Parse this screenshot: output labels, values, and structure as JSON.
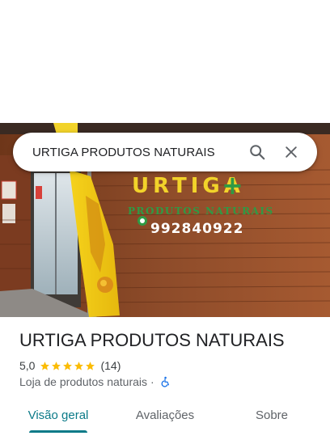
{
  "search": {
    "query": "URTIGA PRODUTOS NATURAIS",
    "search_icon": "search-icon",
    "close_icon": "close-icon"
  },
  "hero": {
    "sign_brand": "URTIGA",
    "sign_subtitle": "PRODUTOS NATURAIS",
    "sign_phone": "992840922",
    "sign_plus_symbol": "+"
  },
  "place": {
    "title": "URTIGA PRODUTOS NATURAIS",
    "rating": "5,0",
    "stars": 5,
    "reviews_count": "(14)",
    "category": "Loja de produtos naturais",
    "separator": "·",
    "accessibility_icon": "wheelchair-icon"
  },
  "tabs": [
    {
      "label": "Visão geral",
      "active": true
    },
    {
      "label": "Avaliações",
      "active": false
    },
    {
      "label": "Sobre",
      "active": false
    }
  ],
  "colors": {
    "accent": "#0b7a88",
    "star": "#fbbc04",
    "wheelchair": "#1a73e8",
    "sign_yellow": "#f2d32a",
    "sign_green": "#2f9a45",
    "wood": "#8a4a28"
  }
}
